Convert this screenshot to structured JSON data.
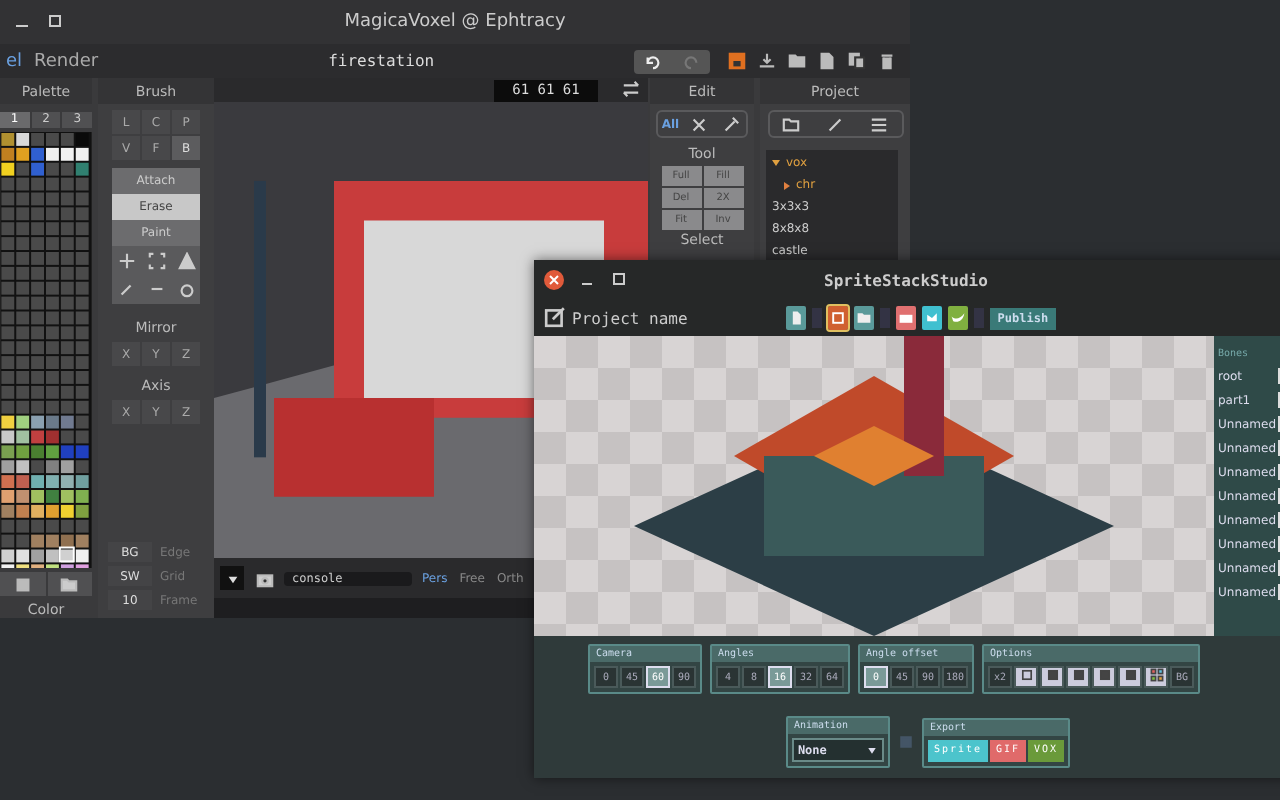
{
  "magicavoxel": {
    "title": "MagicaVoxel @ Ephtracy",
    "menu": [
      {
        "label": "el",
        "selected": true
      },
      {
        "label": "Render",
        "selected": false
      }
    ],
    "file_name": "firestation",
    "palette": {
      "title": "Palette",
      "pages": [
        {
          "label": "1",
          "selected": true
        },
        {
          "label": "2",
          "selected": false
        },
        {
          "label": "3",
          "selected": false
        }
      ],
      "footer": "Color"
    },
    "brush": {
      "title": "Brush",
      "modes": [
        {
          "label": "L",
          "selected": false
        },
        {
          "label": "C",
          "selected": false
        },
        {
          "label": "P",
          "selected": false
        },
        {
          "label": "V",
          "selected": false
        },
        {
          "label": "F",
          "selected": false
        },
        {
          "label": "B",
          "selected": true
        }
      ],
      "actions": [
        {
          "label": "Attach",
          "selected": false
        },
        {
          "label": "Erase",
          "selected": true
        },
        {
          "label": "Paint",
          "selected": false
        }
      ],
      "mirror": {
        "title": "Mirror",
        "axes": [
          "X",
          "Y",
          "Z"
        ]
      },
      "axis": {
        "title": "Axis",
        "axes": [
          "X",
          "Y",
          "Z"
        ]
      },
      "display": [
        {
          "value": "BG",
          "label": "Edge"
        },
        {
          "value": "SW",
          "label": "Grid"
        },
        {
          "value": "10",
          "label": "Frame"
        }
      ]
    },
    "viewport": {
      "color_readout": "61 61 61",
      "console": "console",
      "views": [
        {
          "label": "Pers",
          "selected": true
        },
        {
          "label": "Free",
          "selected": false
        },
        {
          "label": "Orth",
          "selected": false
        }
      ]
    },
    "edit": {
      "title": "Edit",
      "mode": "All",
      "tool_title": "Tool",
      "tools": [
        "Full",
        "Fill",
        "Del",
        "2X",
        "Fit",
        "Inv"
      ],
      "select_title": "Select"
    },
    "project": {
      "title": "Project",
      "items": [
        {
          "label": "vox",
          "expanded": true,
          "children": [
            {
              "label": "chr",
              "expanded": false
            }
          ]
        },
        {
          "label": "3x3x3"
        },
        {
          "label": "8x8x8"
        },
        {
          "label": "castle"
        }
      ]
    }
  },
  "spritestack": {
    "title": "SpriteStackStudio",
    "project_name": "Project name",
    "publish": "Publish",
    "bones": {
      "title": "Bones",
      "items": [
        "root",
        "part1",
        "Unnamed",
        "Unnamed",
        "Unnamed",
        "Unnamed",
        "Unnamed",
        "Unnamed",
        "Unnamed",
        "Unnamed"
      ]
    },
    "groups": [
      {
        "title": "Camera",
        "options": [
          {
            "label": "0",
            "selected": false
          },
          {
            "label": "45",
            "selected": false
          },
          {
            "label": "60",
            "selected": true
          },
          {
            "label": "90",
            "selected": false
          }
        ]
      },
      {
        "title": "Angles",
        "options": [
          {
            "label": "4",
            "selected": false
          },
          {
            "label": "8",
            "selected": false
          },
          {
            "label": "16",
            "selected": true
          },
          {
            "label": "32",
            "selected": false
          },
          {
            "label": "64",
            "selected": false
          }
        ]
      },
      {
        "title": "Angle offset",
        "options": [
          {
            "label": "0",
            "selected": true
          },
          {
            "label": "45",
            "selected": false
          },
          {
            "label": "90",
            "selected": false
          },
          {
            "label": "180",
            "selected": false
          }
        ]
      }
    ],
    "options": {
      "title": "Options",
      "scale": "x2",
      "background": "BG"
    },
    "animation": {
      "title": "Animation",
      "value": "None"
    },
    "export": {
      "title": "Export",
      "buttons": [
        {
          "label": "Sprite",
          "color": "#4cc4cc"
        },
        {
          "label": "GIF",
          "color": "#e06a6a"
        },
        {
          "label": "VOX",
          "color": "#6a9a3a"
        }
      ]
    }
  }
}
